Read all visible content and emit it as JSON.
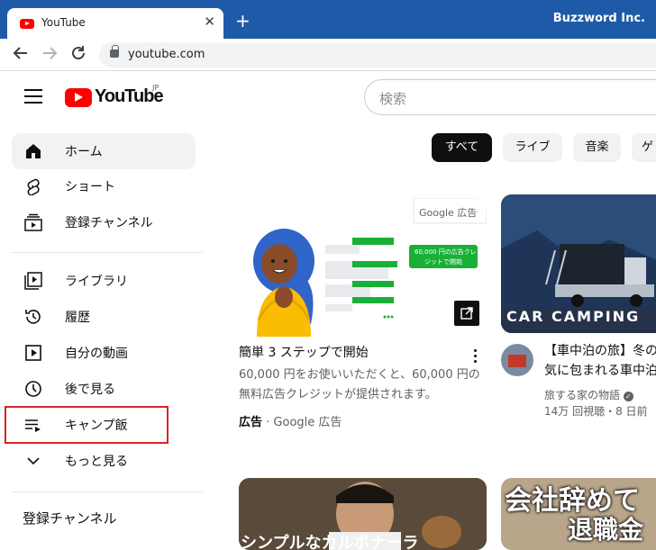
{
  "browser": {
    "tab_title": "YouTube",
    "tab_close": "✕",
    "new_tab": "+",
    "profile_name": "Buzzword Inc.",
    "url": "youtube.com"
  },
  "header": {
    "logo_text": "YouTube",
    "logo_region": "JP",
    "search_placeholder": "検索"
  },
  "sidebar": {
    "main": [
      {
        "label": "ホーム",
        "icon": "home-icon"
      },
      {
        "label": "ショート",
        "icon": "shorts-icon"
      },
      {
        "label": "登録チャンネル",
        "icon": "subscriptions-icon"
      }
    ],
    "library": [
      {
        "label": "ライブラリ",
        "icon": "library-icon"
      },
      {
        "label": "履歴",
        "icon": "history-icon"
      },
      {
        "label": "自分の動画",
        "icon": "your-videos-icon"
      },
      {
        "label": "後で見る",
        "icon": "watch-later-icon"
      },
      {
        "label": "キャンプ飯",
        "icon": "playlist-icon"
      },
      {
        "label": "もっと見る",
        "icon": "chevron-down-icon"
      }
    ],
    "subscriptions_heading": "登録チャンネル"
  },
  "chips": [
    "すべて",
    "ライブ",
    "音楽",
    "ゲ"
  ],
  "ad_card": {
    "badge": "Google 広告",
    "promo_text_1": "60,000 円の広告クレ",
    "promo_text_2": "ジットで開始",
    "title": "簡単 3 ステップで開始",
    "desc_1": "60,000 円をお使いいただくと、60,000 円の",
    "desc_2": "無料広告クレジットが提供されます。",
    "ad_label": "広告",
    "ad_source": " · Google 広告"
  },
  "video_card": {
    "thumb_text": "CAR CAMPING",
    "title_1": "【車中泊の旅】冬の",
    "title_2": "気に包まれる車中泊",
    "channel": "旅する家の物語",
    "stats": "14万 回視聴・8 日前"
  },
  "row2": {
    "thumb_left_text": "シンプルなカルボナーラ",
    "thumb_right_text_1": "会社辞めて",
    "thumb_right_text_2": "退職金"
  },
  "colors": {
    "accent": "#ff0000",
    "highlight": "#d9252b",
    "tabbar": "#1e5aa8"
  }
}
